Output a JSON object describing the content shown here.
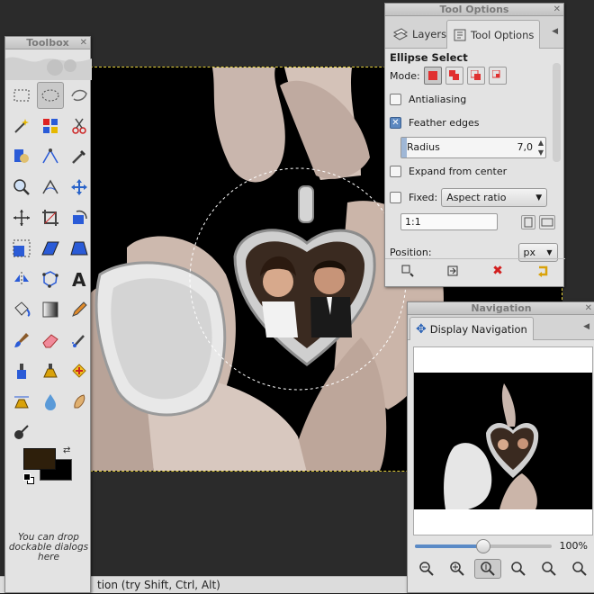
{
  "statusbar": {
    "text": "tion (try Shift, Ctrl, Alt)"
  },
  "toolbox": {
    "title": "Toolbox",
    "drop_hint": "You can drop dockable dialogs here",
    "tools": [
      {
        "name": "rect-select-icon"
      },
      {
        "name": "ellipse-select-icon",
        "active": true
      },
      {
        "name": "free-select-icon"
      },
      {
        "name": "fuzzy-select-icon"
      },
      {
        "name": "color-select-icon"
      },
      {
        "name": "scissors-icon"
      },
      {
        "name": "foreground-select-icon"
      },
      {
        "name": "paths-icon"
      },
      {
        "name": "color-picker-icon"
      },
      {
        "name": "zoom-icon"
      },
      {
        "name": "measure-icon"
      },
      {
        "name": "move-icon"
      },
      {
        "name": "align-icon"
      },
      {
        "name": "crop-icon"
      },
      {
        "name": "rotate-icon"
      },
      {
        "name": "scale-icon"
      },
      {
        "name": "shear-icon"
      },
      {
        "name": "perspective-icon"
      },
      {
        "name": "flip-icon"
      },
      {
        "name": "cage-icon"
      },
      {
        "name": "text-icon"
      },
      {
        "name": "bucket-fill-icon"
      },
      {
        "name": "blend-icon"
      },
      {
        "name": "pencil-icon"
      },
      {
        "name": "paintbrush-icon"
      },
      {
        "name": "eraser-icon"
      },
      {
        "name": "airbrush-icon"
      },
      {
        "name": "ink-icon"
      },
      {
        "name": "clone-icon"
      },
      {
        "name": "heal-icon"
      },
      {
        "name": "perspective-clone-icon"
      },
      {
        "name": "blur-icon"
      },
      {
        "name": "smudge-icon"
      },
      {
        "name": "dodge-burn-icon"
      }
    ],
    "colors": {
      "foreground": "#2e1f0b",
      "background": "#000000"
    }
  },
  "tool_options": {
    "title": "Tool Options",
    "tabs": [
      {
        "label": "Layers"
      },
      {
        "label": "Tool Options"
      }
    ],
    "heading": "Ellipse Select",
    "mode_label": "Mode:",
    "antialiasing_label": "Antialiasing",
    "antialiasing": false,
    "feather_label": "Feather edges",
    "feather": true,
    "radius_label": "Radius",
    "radius_value": "7,0",
    "expand_label": "Expand from center",
    "expand": false,
    "fixed_label": "Fixed:",
    "fixed": false,
    "fixed_option": "Aspect ratio",
    "ratio_value": "1:1",
    "position_label": "Position:",
    "unit": "px",
    "accent": "#e03030"
  },
  "navigation": {
    "title": "Navigation",
    "tab_label": "Display Navigation",
    "zoom_label": "100%",
    "zoom_fraction": 0.5
  }
}
